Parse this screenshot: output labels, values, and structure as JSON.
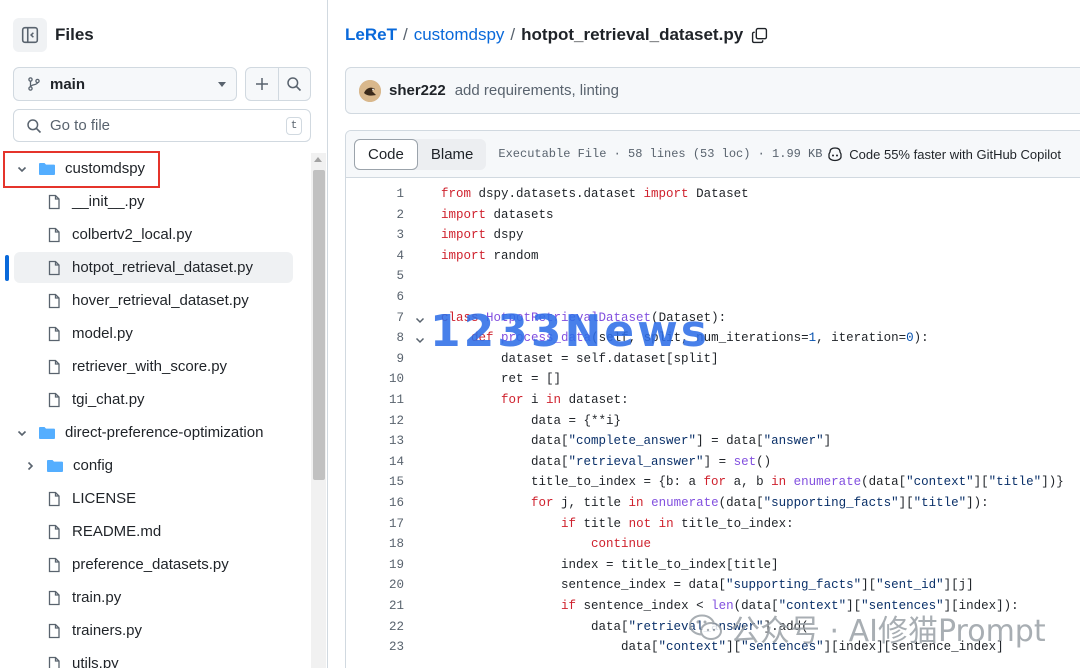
{
  "sidebar": {
    "title": "Files",
    "branch": "main",
    "goto_placeholder": "Go to file",
    "goto_shortcut": "t",
    "tree": [
      {
        "type": "folder",
        "name": "customdspy",
        "expanded": true,
        "depth": 0,
        "highlighted": true
      },
      {
        "type": "file",
        "name": "__init__.py",
        "depth": 1
      },
      {
        "type": "file",
        "name": "colbertv2_local.py",
        "depth": 1
      },
      {
        "type": "file",
        "name": "hotpot_retrieval_dataset.py",
        "depth": 1,
        "active": true
      },
      {
        "type": "file",
        "name": "hover_retrieval_dataset.py",
        "depth": 1
      },
      {
        "type": "file",
        "name": "model.py",
        "depth": 1
      },
      {
        "type": "file",
        "name": "retriever_with_score.py",
        "depth": 1
      },
      {
        "type": "file",
        "name": "tgi_chat.py",
        "depth": 1
      },
      {
        "type": "folder",
        "name": "direct-preference-optimization",
        "expanded": true,
        "depth": 0
      },
      {
        "type": "folder",
        "name": "config",
        "expanded": false,
        "depth": 1
      },
      {
        "type": "file",
        "name": "LICENSE",
        "depth": 1
      },
      {
        "type": "file",
        "name": "README.md",
        "depth": 1
      },
      {
        "type": "file",
        "name": "preference_datasets.py",
        "depth": 1
      },
      {
        "type": "file",
        "name": "train.py",
        "depth": 1
      },
      {
        "type": "file",
        "name": "trainers.py",
        "depth": 1
      },
      {
        "type": "file",
        "name": "utils.py",
        "depth": 1
      }
    ]
  },
  "breadcrumb": {
    "owner": "LeReT",
    "sep": "/",
    "folder": "customdspy",
    "file": "hotpot_retrieval_dataset.py"
  },
  "commit": {
    "author": "sher222",
    "message": "add requirements, linting"
  },
  "file_header": {
    "tab_code": "Code",
    "tab_blame": "Blame",
    "meta": "Executable File · 58 lines (53 loc) · 1.99 KB",
    "copilot": "Code 55% faster with GitHub Copilot"
  },
  "code_lines": [
    "from dspy.datasets.dataset import Dataset",
    "import datasets",
    "import dspy",
    "import random",
    "",
    "",
    "class HotpotRetrievalDataset(Dataset):",
    "    def process_data(self, split, num_iterations=1, iteration=0):",
    "        dataset = self.dataset[split]",
    "        ret = []",
    "        for i in dataset:",
    "            data = {**i}",
    "            data[\"complete_answer\"] = data[\"answer\"]",
    "            data[\"retrieval_answer\"] = set()",
    "            title_to_index = {b: a for a, b in enumerate(data[\"context\"][\"title\"])}",
    "            for j, title in enumerate(data[\"supporting_facts\"][\"title\"]):",
    "                if title not in title_to_index:",
    "                    continue",
    "                index = title_to_index[title]",
    "                sentence_index = data[\"supporting_facts\"][\"sent_id\"][j]",
    "                if sentence_index < len(data[\"context\"][\"sentences\"][index]):",
    "                    data[\"retrieval_answer\"].add(",
    "                        data[\"context\"][\"sentences\"][index][sentence_index]"
  ],
  "watermarks": {
    "main": "1233News",
    "wechat": "公众号 · AI修猫Prompt"
  },
  "colors": {
    "accent": "#0969da",
    "highlight_border": "#e5342b",
    "keyword": "#cf222e",
    "string": "#0a3069",
    "number": "#0550ae",
    "function": "#8250df"
  }
}
